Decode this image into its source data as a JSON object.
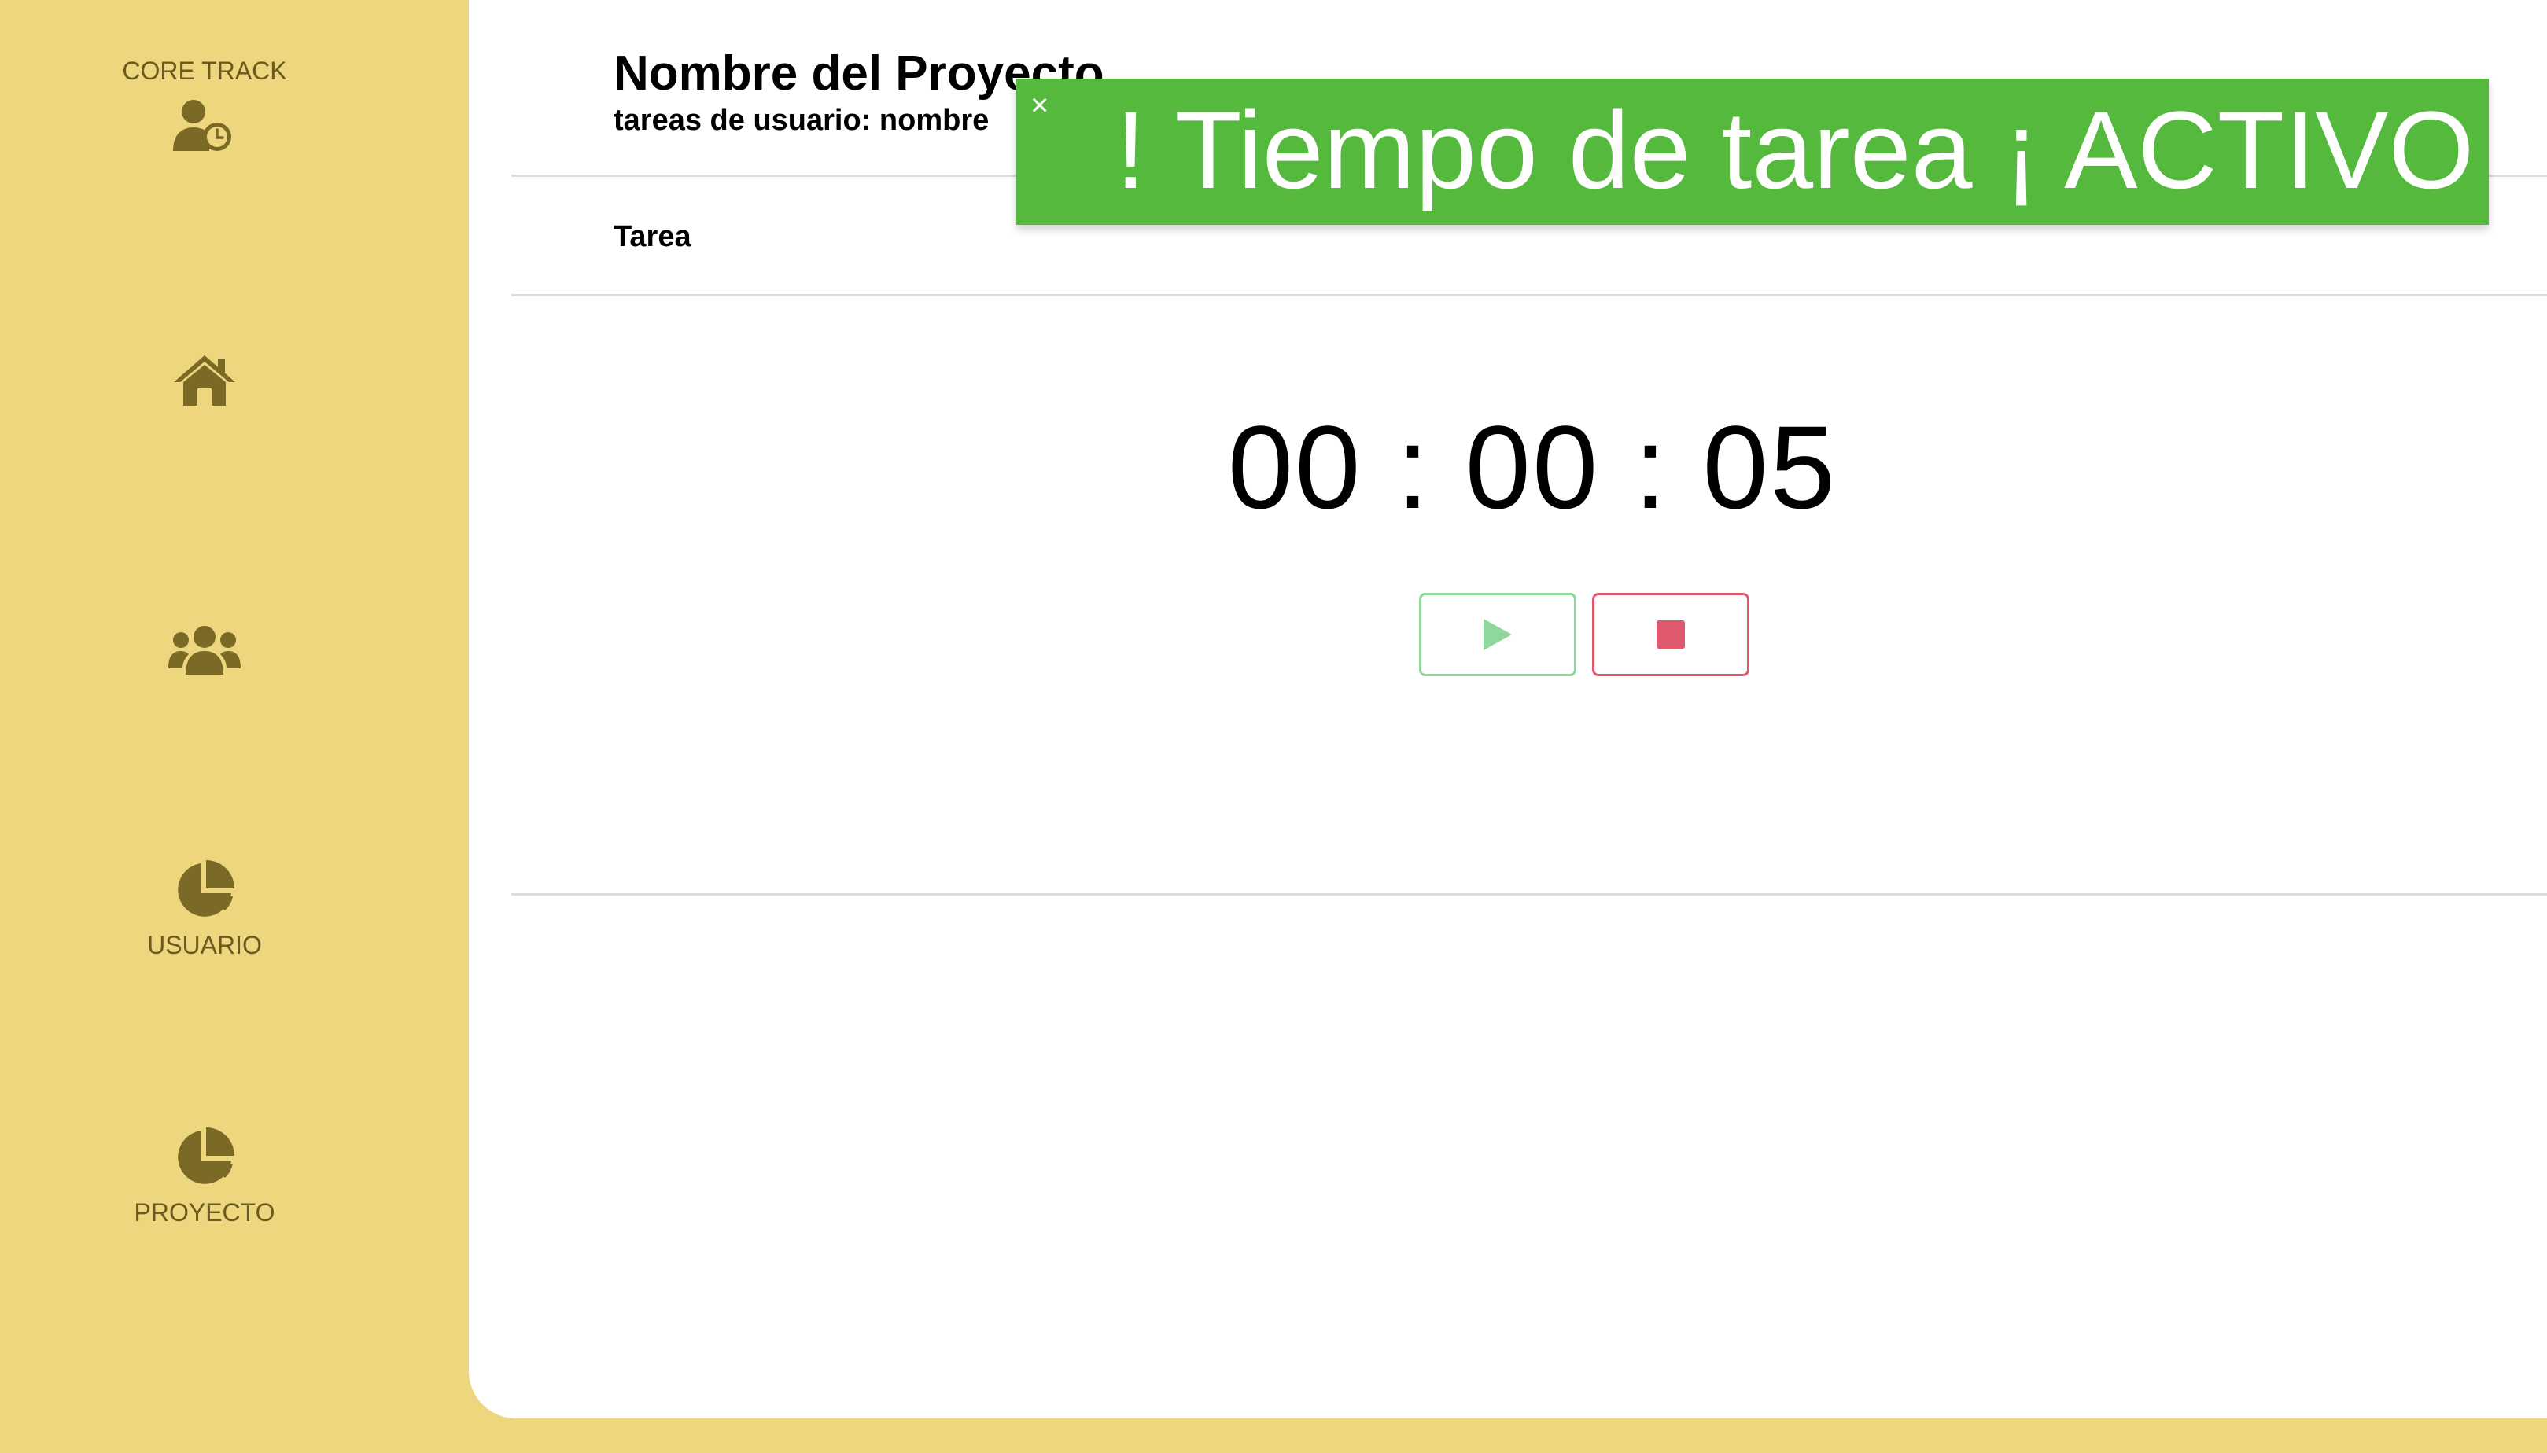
{
  "sidebar": {
    "brand": "CORE TRACK",
    "items": [
      {
        "name": "home",
        "label": ""
      },
      {
        "name": "users",
        "label": ""
      },
      {
        "name": "usuario",
        "label": "USUARIO"
      },
      {
        "name": "proyecto",
        "label": "PROYECTO"
      }
    ]
  },
  "header": {
    "title": "Nombre del Proyecto",
    "subtitle": "tareas de usuario: nombre"
  },
  "task": {
    "label": "Tarea"
  },
  "timer": {
    "display": "00 : 00 : 05"
  },
  "toast": {
    "close_symbol": "×",
    "message": "! Tiempo de tarea ¡ ACTIVO"
  },
  "colors": {
    "sidebar_bg": "#eed67e",
    "sidebar_icon": "#7a6a26",
    "toast_bg": "#55b93d",
    "play": "#8fd79a",
    "stop": "#e0586c"
  },
  "icons": {
    "brand": "user-clock-icon",
    "home": "home-icon",
    "users": "users-icon",
    "usuario": "pie-chart-icon",
    "proyecto": "pie-chart-icon",
    "play": "play-icon",
    "stop": "stop-icon",
    "close": "close-icon"
  }
}
